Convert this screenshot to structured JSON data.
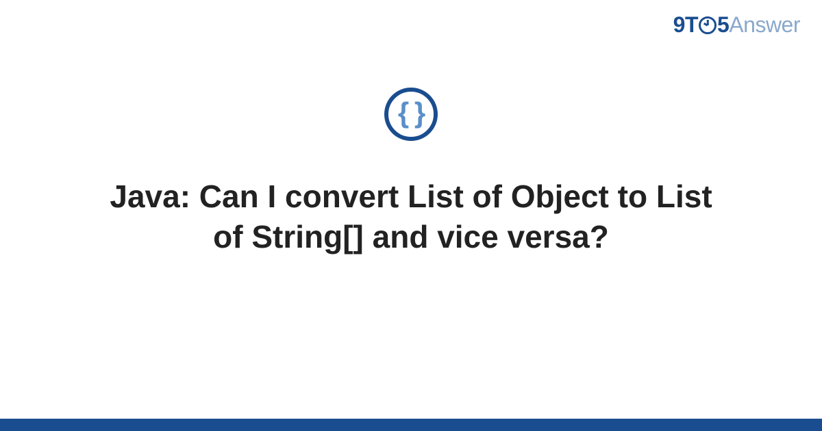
{
  "brand": {
    "part1": "9T",
    "part2": "5",
    "part3": "Answer"
  },
  "icon": {
    "glyph": "{ }"
  },
  "title": "Java: Can I convert List of Object to List of String[] and vice versa?",
  "colors": {
    "primary": "#1a4d8f",
    "accent": "#5a8fc9",
    "muted": "#8aa8cc",
    "text": "#222222"
  }
}
